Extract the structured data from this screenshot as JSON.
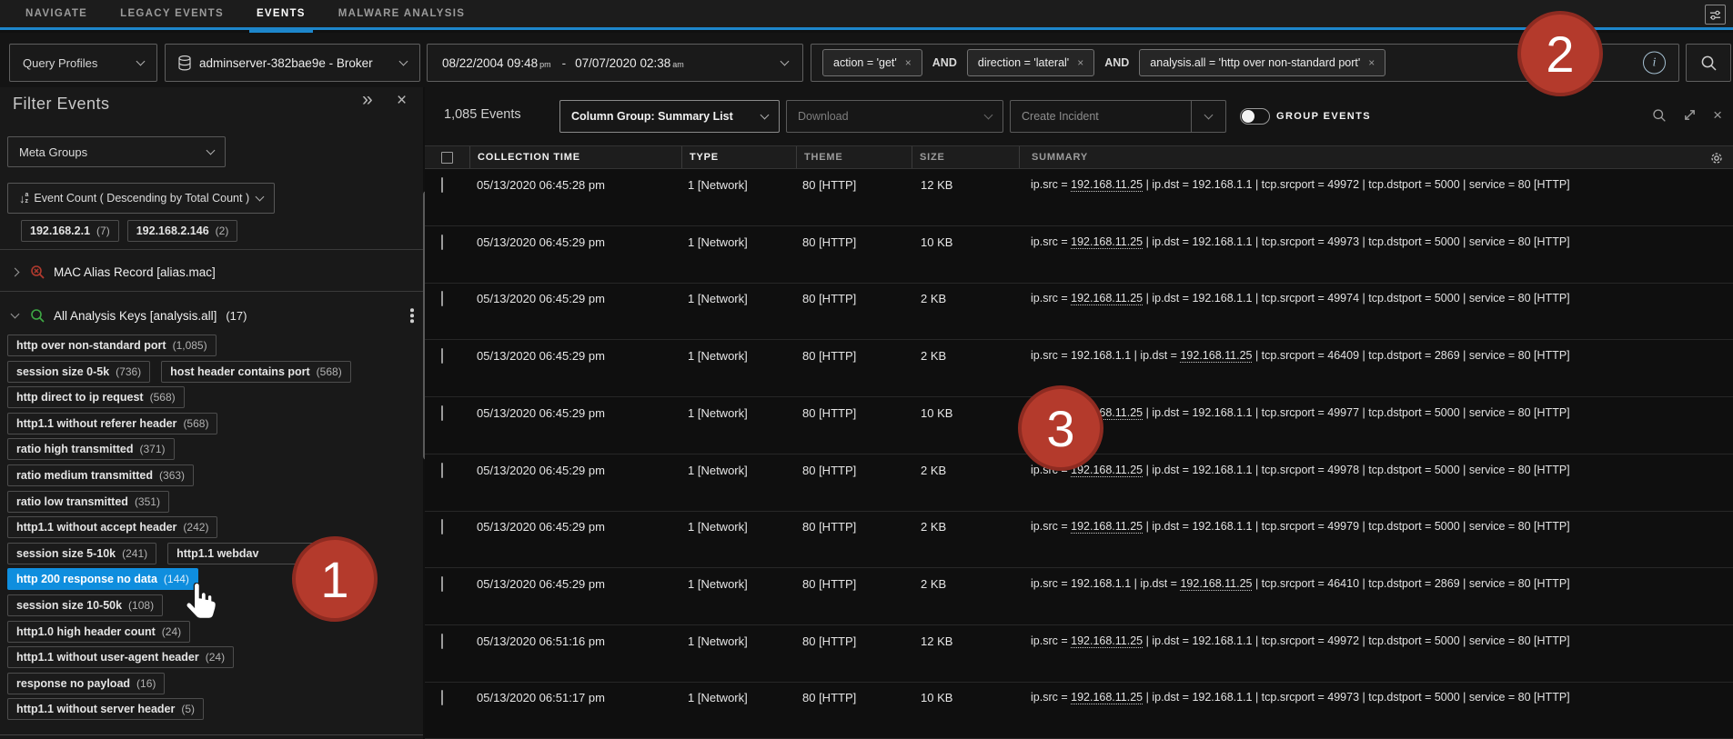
{
  "nav": {
    "items": [
      {
        "label": "NAVIGATE",
        "active": false
      },
      {
        "label": "LEGACY EVENTS",
        "active": false
      },
      {
        "label": "EVENTS",
        "active": true
      },
      {
        "label": "MALWARE ANALYSIS",
        "active": false
      }
    ],
    "accent_color": "#1d86cb"
  },
  "query_bar": {
    "profiles_label": "Query Profiles",
    "broker_label": "adminserver-382bae9e - Broker",
    "date_range": {
      "start": "08/22/2004 09:48",
      "start_ampm": "pm",
      "separator": "-",
      "end": "07/07/2020 02:38",
      "end_ampm": "am"
    },
    "operator": "AND",
    "pills": [
      {
        "text": "action = 'get'"
      },
      {
        "text": "direction = 'lateral'"
      },
      {
        "text": "analysis.all = 'http over non-standard port'"
      }
    ],
    "close_glyph": "×"
  },
  "sidebar": {
    "title": "Filter Events",
    "collapse_glyph": "»",
    "close_glyph": "×",
    "meta_groups_label": "Meta Groups",
    "sort_label": "Event Count ( Descending by Total Count )",
    "meta_value_chips": [
      {
        "label": "192.168.2.1",
        "count": "(7)"
      },
      {
        "label": "192.168.2.146",
        "count": "(2)"
      }
    ],
    "groups": [
      {
        "label": "MAC Alias Record [alias.mac]",
        "count": "",
        "expanded": false,
        "icon": "red-search-icon"
      },
      {
        "label": "All Analysis Keys [analysis.all]",
        "count": "(17)",
        "expanded": true,
        "icon": "green-search-icon"
      }
    ],
    "chip_rows": [
      [
        {
          "label": "http over non-standard port",
          "count": "(1,085)"
        }
      ],
      [
        {
          "label": "session size 0-5k",
          "count": "(736)"
        },
        {
          "label": "host header contains port",
          "count": "(568)"
        }
      ],
      [
        {
          "label": "http direct to ip request",
          "count": "(568)"
        }
      ],
      [
        {
          "label": "http1.1 without referer header",
          "count": "(568)"
        }
      ],
      [
        {
          "label": "ratio high transmitted",
          "count": "(371)"
        }
      ],
      [
        {
          "label": "ratio medium transmitted",
          "count": "(363)"
        }
      ],
      [
        {
          "label": "ratio low transmitted",
          "count": "(351)"
        }
      ],
      [
        {
          "label": "http1.1 without accept header",
          "count": "(242)"
        }
      ],
      [
        {
          "label": "session size 5-10k",
          "count": "(241)"
        },
        {
          "label": "http1.1 webdav",
          "count": "",
          "truncated": true
        }
      ],
      [
        {
          "label": "http 200 response no data",
          "count": "(144)",
          "selected": true
        }
      ],
      [
        {
          "label": "session size 10-50k",
          "count": "(108)"
        }
      ],
      [
        {
          "label": "http1.0 high header count",
          "count": "(24)"
        }
      ],
      [
        {
          "label": "http1.1 without user-agent header",
          "count": "(24)"
        }
      ],
      [
        {
          "label": "response no payload",
          "count": "(16)"
        }
      ],
      [
        {
          "label": "http1.1 without server header",
          "count": "(5)"
        }
      ]
    ]
  },
  "toolbar": {
    "events_count": "1,085 Events",
    "column_group_label": "Column Group: Summary List",
    "download_label": "Download",
    "create_incident_label": "Create Incident",
    "group_events_label": "GROUP EVENTS",
    "close_glyph": "×"
  },
  "table": {
    "columns": [
      "COLLECTION TIME",
      "TYPE",
      "THEME",
      "SIZE",
      "SUMMARY"
    ],
    "underline_value": "192.168.11.25",
    "rows": [
      {
        "time": "05/13/2020 06:45:28 pm",
        "type": "1 [Network]",
        "theme": "80 [HTTP]",
        "size": "12 KB",
        "summary": "ip.src = 192.168.11.25 | ip.dst = 192.168.1.1 | tcp.srcport = 49972 | tcp.dstport = 5000 | service = 80 [HTTP]"
      },
      {
        "time": "05/13/2020 06:45:29 pm",
        "type": "1 [Network]",
        "theme": "80 [HTTP]",
        "size": "10 KB",
        "summary": "ip.src = 192.168.11.25 | ip.dst = 192.168.1.1 | tcp.srcport = 49973 | tcp.dstport = 5000 | service = 80 [HTTP]"
      },
      {
        "time": "05/13/2020 06:45:29 pm",
        "type": "1 [Network]",
        "theme": "80 [HTTP]",
        "size": "2 KB",
        "summary": "ip.src = 192.168.11.25 | ip.dst = 192.168.1.1 | tcp.srcport = 49974 | tcp.dstport = 5000 | service = 80 [HTTP]"
      },
      {
        "time": "05/13/2020 06:45:29 pm",
        "type": "1 [Network]",
        "theme": "80 [HTTP]",
        "size": "2 KB",
        "summary": "ip.src = 192.168.1.1 | ip.dst = 192.168.11.25 | tcp.srcport = 46409 | tcp.dstport = 2869 | service = 80 [HTTP]"
      },
      {
        "time": "05/13/2020 06:45:29 pm",
        "type": "1 [Network]",
        "theme": "80 [HTTP]",
        "size": "10 KB",
        "summary": "ip.src = 192.168.11.25 | ip.dst = 192.168.1.1 | tcp.srcport = 49977 | tcp.dstport = 5000 | service = 80 [HTTP]"
      },
      {
        "time": "05/13/2020 06:45:29 pm",
        "type": "1 [Network]",
        "theme": "80 [HTTP]",
        "size": "2 KB",
        "summary": "ip.src = 192.168.11.25 | ip.dst = 192.168.1.1 | tcp.srcport = 49978 | tcp.dstport = 5000 | service = 80 [HTTP]"
      },
      {
        "time": "05/13/2020 06:45:29 pm",
        "type": "1 [Network]",
        "theme": "80 [HTTP]",
        "size": "2 KB",
        "summary": "ip.src = 192.168.11.25 | ip.dst = 192.168.1.1 | tcp.srcport = 49979 | tcp.dstport = 5000 | service = 80 [HTTP]"
      },
      {
        "time": "05/13/2020 06:45:29 pm",
        "type": "1 [Network]",
        "theme": "80 [HTTP]",
        "size": "2 KB",
        "summary": "ip.src = 192.168.1.1 | ip.dst = 192.168.11.25 | tcp.srcport = 46410 | tcp.dstport = 2869 | service = 80 [HTTP]"
      },
      {
        "time": "05/13/2020 06:51:16 pm",
        "type": "1 [Network]",
        "theme": "80 [HTTP]",
        "size": "12 KB",
        "summary": "ip.src = 192.168.11.25 | ip.dst = 192.168.1.1 | tcp.srcport = 49972 | tcp.dstport = 5000 | service = 80 [HTTP]"
      },
      {
        "time": "05/13/2020 06:51:17 pm",
        "type": "1 [Network]",
        "theme": "80 [HTTP]",
        "size": "10 KB",
        "summary": "ip.src = 192.168.11.25 | ip.dst = 192.168.1.1 | tcp.srcport = 49973 | tcp.dstport = 5000 | service = 80 [HTTP]"
      }
    ]
  },
  "annotations": {
    "badges": [
      {
        "label": "1"
      },
      {
        "label": "2"
      },
      {
        "label": "3"
      }
    ],
    "badge_color": "#b43a2c"
  }
}
